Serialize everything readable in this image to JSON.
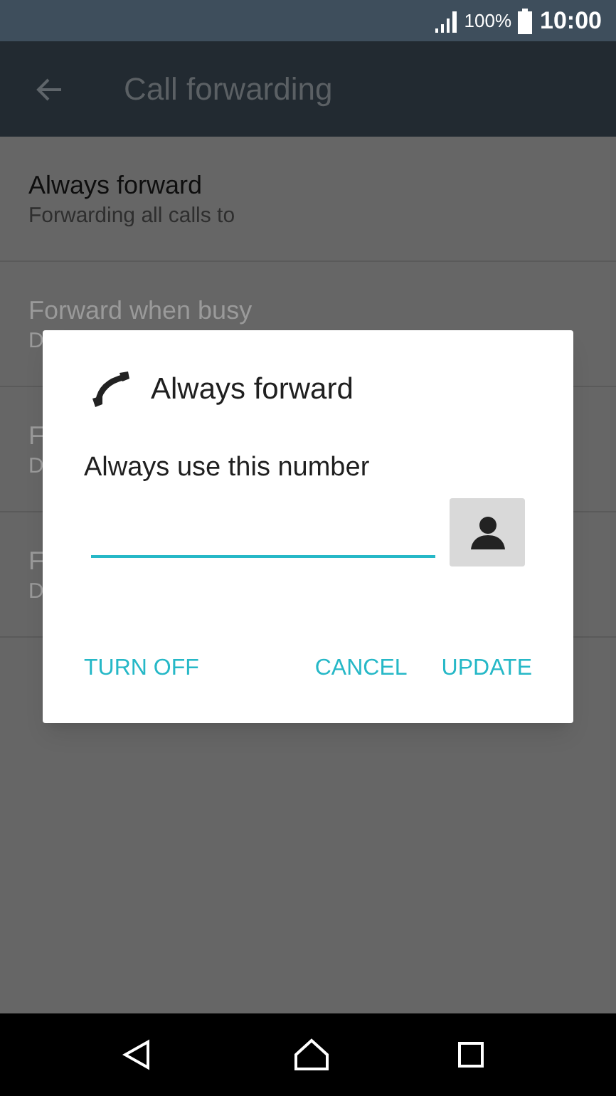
{
  "status_bar": {
    "battery": "100%",
    "time": "10:00"
  },
  "app_bar": {
    "title": "Call forwarding"
  },
  "settings": [
    {
      "title": "Always forward",
      "subtitle": "Forwarding all calls to",
      "disabled": false
    },
    {
      "title": "Forward when busy",
      "subtitle": "D",
      "disabled": true
    },
    {
      "title": "F",
      "subtitle": "D",
      "disabled": true
    },
    {
      "title": "F",
      "subtitle": "D",
      "disabled": true
    }
  ],
  "dialog": {
    "title": "Always forward",
    "label": "Always use this number",
    "buttons": [
      "TURN OFF",
      "CANCEL",
      "UPDATE"
    ]
  }
}
